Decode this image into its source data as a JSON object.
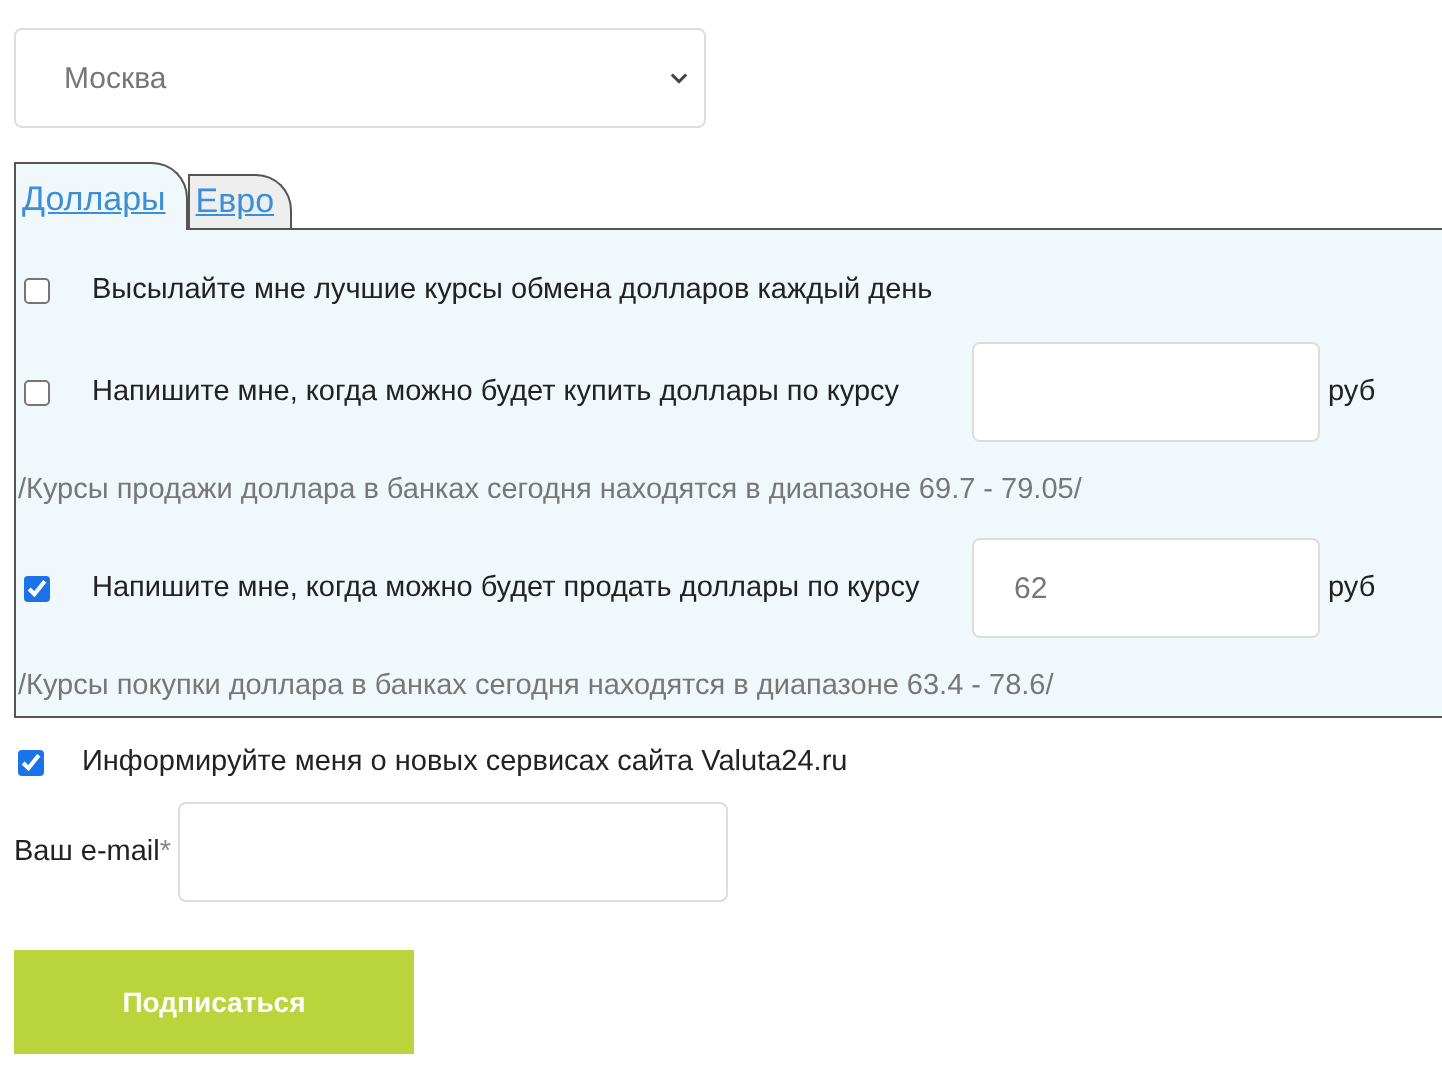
{
  "city_select": {
    "value": "Москва"
  },
  "tabs": [
    {
      "label": "Доллары",
      "selected": true
    },
    {
      "label": "Евро",
      "selected": false
    }
  ],
  "panel": {
    "rows": [
      {
        "kind": "check",
        "checked": false,
        "label": "Высылайте мне лучшие курсы обмена долларов каждый день"
      },
      {
        "kind": "rate",
        "checked": false,
        "label": "Напишите мне, когда можно будет купить доллары по курсу",
        "value": "",
        "unit": "руб"
      },
      {
        "kind": "hint",
        "text": "/Курсы продажи доллара в банках сегодня находятся в диапазоне 69.7 - 79.05/"
      },
      {
        "kind": "rate",
        "checked": true,
        "label": "Напишите мне, когда можно будет продать доллары по курсу",
        "value": "62",
        "unit": "руб"
      },
      {
        "kind": "hint",
        "text": "/Курсы покупки доллара в банках сегодня находятся в диапазоне 63.4 - 78.6/"
      }
    ]
  },
  "news_option": {
    "checked": true,
    "label": "Информируйте меня о новых сервисах сайта Valuta24.ru"
  },
  "email": {
    "label": "Ваш e-mail",
    "required_mark": "*"
  },
  "submit_button": "Подписаться"
}
